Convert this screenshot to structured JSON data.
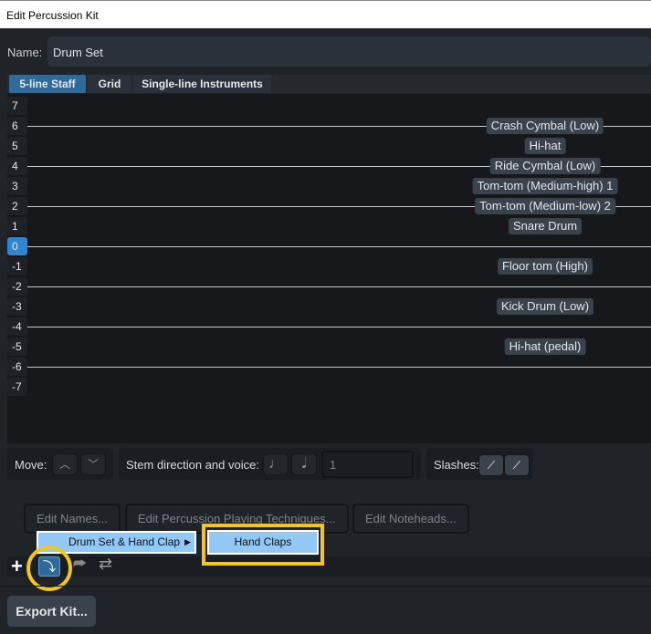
{
  "window": {
    "title": "Edit Percussion Kit"
  },
  "name_label": "Name:",
  "name_value": "Drum Set",
  "tabs": [
    "5-line Staff",
    "Grid",
    "Single-line Instruments"
  ],
  "staff_positions": [
    "7",
    "6",
    "5",
    "4",
    "3",
    "2",
    "1",
    "0",
    "-1",
    "-2",
    "-3",
    "-4",
    "-5",
    "-6",
    "-7"
  ],
  "selected_position": "0",
  "instruments": [
    {
      "name": "Crash Cymbal (Low)",
      "position": 6
    },
    {
      "name": "Hi-hat",
      "position": 5
    },
    {
      "name": "Ride Cymbal (Low)",
      "position": 4
    },
    {
      "name": "Tom-tom (Medium-high) 1",
      "position": 3
    },
    {
      "name": "Tom-tom (Medium-low) 2",
      "position": 2
    },
    {
      "name": "Snare Drum",
      "position": 1
    },
    {
      "name": "Floor tom (High)",
      "position": -1
    },
    {
      "name": "Kick Drum (Low)",
      "position": -3
    },
    {
      "name": "Hi-hat (pedal)",
      "position": -5
    }
  ],
  "move": {
    "label": "Move:"
  },
  "stem": {
    "label": "Stem direction and voice:",
    "voice": "1"
  },
  "slashes": {
    "label": "Slashes:"
  },
  "buttons": {
    "edit_names": "Edit Names...",
    "edit_techniques": "Edit Percussion Playing Techniques...",
    "edit_noteheads": "Edit Noteheads...",
    "export": "Export Kit..."
  },
  "menu": {
    "item": "Drum Set & Hand Clap",
    "submenu_item": "Hand Claps"
  },
  "colors": {
    "accent": "#2f86d0",
    "highlight": "#f5c518",
    "menu_hover": "#91c8f6"
  }
}
